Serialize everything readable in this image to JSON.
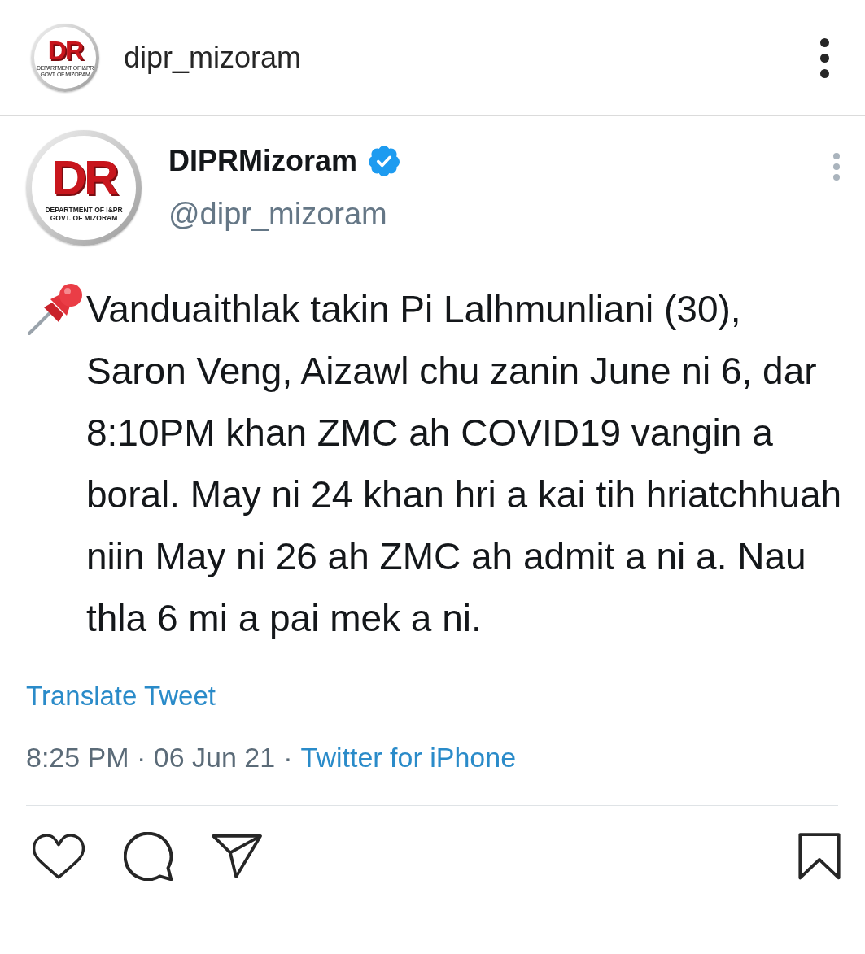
{
  "header": {
    "avatar": {
      "letters": "DR",
      "lines": [
        "DEPARTMENT OF I&PR",
        "GOVT. OF MIZORAM"
      ]
    },
    "username": "dipr_mizoram"
  },
  "tweet": {
    "avatar": {
      "letters": "DR",
      "lines": [
        "DEPARTMENT OF I&PR",
        "GOVT. OF MIZORAM"
      ]
    },
    "name": "DIPRMizoram",
    "verified": true,
    "handle": "@dipr_mizoram",
    "text": "Vanduaithlak takin Pi Lalhmunliani (30), Saron Veng, Aizawl chu zanin June ni 6, dar 8:10PM khan ZMC ah COVID19 vangin a boral. May ni 24 khan hri a kai tih hriatchhuah niin May ni 26 ah ZMC ah admit a ni a. Nau thla 6 mi a pai mek a ni.",
    "translate": "Translate Tweet",
    "timestamp": "8:25 PM · 06 Jun 21",
    "separator": "·",
    "source": "Twitter for iPhone"
  },
  "actions": {
    "liked": false,
    "saved": false
  }
}
